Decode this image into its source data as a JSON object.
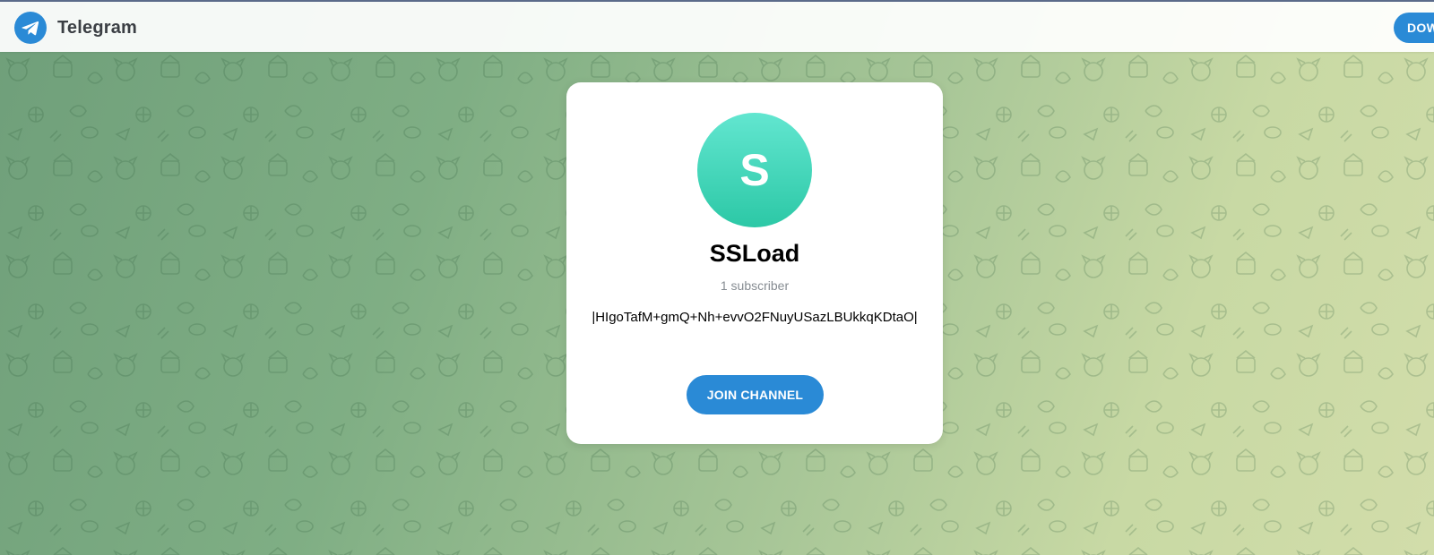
{
  "header": {
    "brand": "Telegram",
    "download_label": "DOWNLOAD"
  },
  "channel": {
    "avatar_letter": "S",
    "title": "SSLoad",
    "subscribers": "1 subscriber",
    "description": "|HIgoTafM+gmQ+Nh+evvO2FNuyUSazLBUkkqKDtaO|",
    "join_label": "JOIN CHANNEL"
  },
  "icons": {
    "logo": "telegram-paper-plane-icon"
  },
  "colors": {
    "accent": "#2a8ad6",
    "avatar_top": "#62e6d0",
    "avatar_bottom": "#2cc8a6",
    "background_left": "#6f9f7a",
    "background_right": "#d2ddaa"
  }
}
